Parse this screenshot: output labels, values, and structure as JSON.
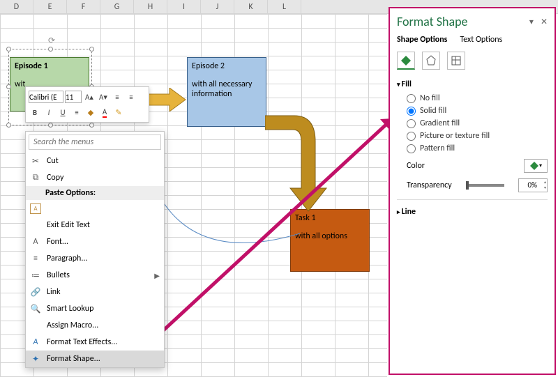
{
  "columns": [
    "D",
    "E",
    "F",
    "G",
    "H",
    "I",
    "J",
    "K",
    "L"
  ],
  "shapes": {
    "ep1": {
      "title": "Episode 1",
      "body": "wit"
    },
    "ep2": {
      "title": "Episode 2",
      "body": "with all necessary information"
    },
    "task": {
      "title": "Task 1",
      "body": "with all options"
    }
  },
  "mini": {
    "font": "Calibri (E",
    "size": "11",
    "bold": "B",
    "italic": "I",
    "underline": "U"
  },
  "ctx": {
    "search_placeholder": "Search the menus",
    "cut": "Cut",
    "copy": "Copy",
    "paste_hdr": "Paste Options:",
    "exit": "Exit Edit Text",
    "font": "Font...",
    "para": "Paragraph...",
    "bullets": "Bullets",
    "link": "Link",
    "lookup": "Smart Lookup",
    "macro": "Assign Macro...",
    "texteffects": "Format Text Effects...",
    "formatshape": "Format Shape..."
  },
  "panel": {
    "title": "Format Shape",
    "tab_shape": "Shape Options",
    "tab_text": "Text Options",
    "fill": "Fill",
    "nofill": "No fill",
    "solid": "Solid fill",
    "gradient": "Gradient fill",
    "picture": "Picture or texture fill",
    "pattern": "Pattern fill",
    "color": "Color",
    "transparency": "Transparency",
    "pct": "0%",
    "line": "Line"
  }
}
